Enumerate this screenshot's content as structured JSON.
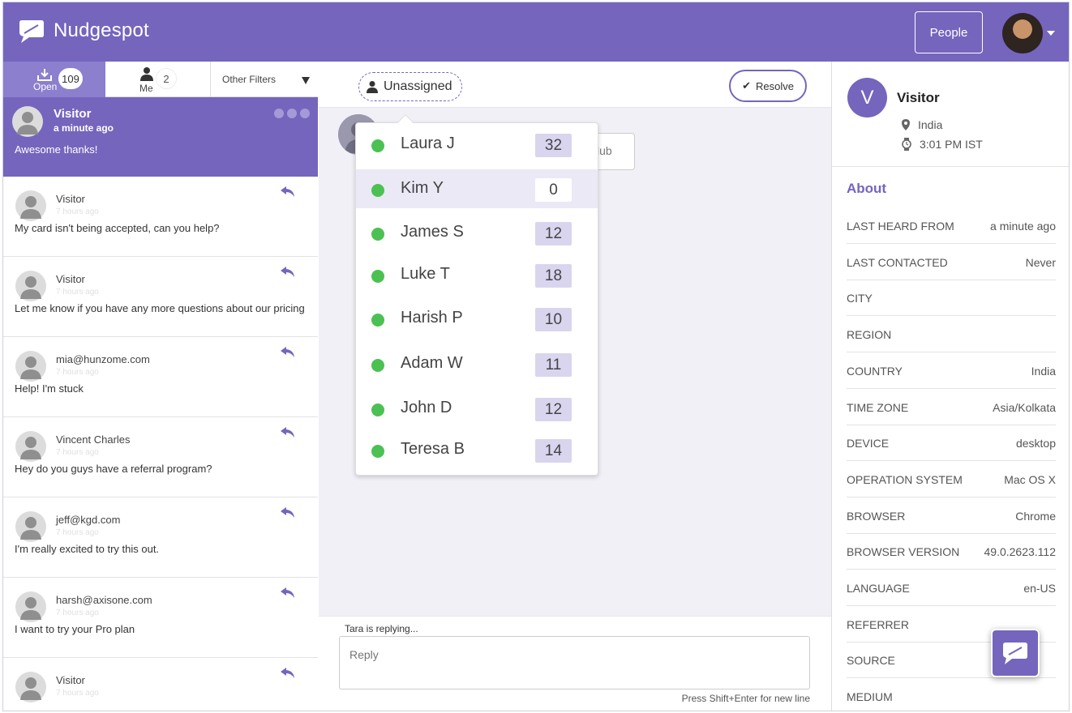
{
  "colors": {
    "brand": "#7565bd",
    "online": "#4cc153"
  },
  "header": {
    "app_name": "Nudgespot",
    "people_label": "People"
  },
  "filters": {
    "open_label": "Open",
    "open_count": "109",
    "me_label": "Me",
    "me_count": "2",
    "other_label": "Other Filters"
  },
  "active_conversation": {
    "name": "Visitor",
    "time": "a minute ago",
    "message": "Awesome thanks!"
  },
  "conversations": [
    {
      "name": "Visitor",
      "time": "7 hours ago",
      "message": "My card isn't being accepted, can you help?"
    },
    {
      "name": "Visitor",
      "time": "7 hours ago",
      "message": "Let me know if you have any more questions about our pricing"
    },
    {
      "name": "mia@hunzome.com",
      "time": "7 hours ago",
      "message": "Help! I'm stuck"
    },
    {
      "name": "Vincent Charles",
      "time": "7 hours ago",
      "message": "Hey do you guys have a referral program?"
    },
    {
      "name": "jeff@kgd.com",
      "time": "7 hours ago",
      "message": "I'm really excited to try this out."
    },
    {
      "name": "harsh@axisone.com",
      "time": "7 hours ago",
      "message": "I want to try your Pro plan"
    },
    {
      "name": "Visitor",
      "time": "7 hours ago",
      "message": ""
    }
  ],
  "toolbar": {
    "assign_label": "Unassigned",
    "resolve_label": "Resolve"
  },
  "message_partial": "lub",
  "agents": [
    {
      "name": "Laura J",
      "count": "32"
    },
    {
      "name": "Kim Y",
      "count": "0"
    },
    {
      "name": "James S",
      "count": "12"
    },
    {
      "name": "Luke T",
      "count": "18"
    },
    {
      "name": "Harish P",
      "count": "10"
    },
    {
      "name": "Adam W",
      "count": "11"
    },
    {
      "name": "John D",
      "count": "12"
    },
    {
      "name": "Teresa B",
      "count": "14"
    }
  ],
  "reply": {
    "status": "Tara is replying...",
    "placeholder": "Reply",
    "hint": "Press Shift+Enter for new line"
  },
  "profile": {
    "initial": "V",
    "name": "Visitor",
    "location": "India",
    "local_time": "3:01 PM IST"
  },
  "about": {
    "title": "About",
    "attributes": [
      {
        "key": "LAST HEARD FROM",
        "value": "a minute ago"
      },
      {
        "key": "LAST CONTACTED",
        "value": "Never"
      },
      {
        "key": "CITY",
        "value": ""
      },
      {
        "key": "REGION",
        "value": ""
      },
      {
        "key": "COUNTRY",
        "value": "India"
      },
      {
        "key": "TIME ZONE",
        "value": "Asia/Kolkata"
      },
      {
        "key": "DEVICE",
        "value": "desktop"
      },
      {
        "key": "OPERATION SYSTEM",
        "value": "Mac OS X"
      },
      {
        "key": "BROWSER",
        "value": "Chrome"
      },
      {
        "key": "BROWSER VERSION",
        "value": "49.0.2623.112"
      },
      {
        "key": "LANGUAGE",
        "value": "en-US"
      },
      {
        "key": "REFERRER",
        "value": ""
      },
      {
        "key": "SOURCE",
        "value": ""
      },
      {
        "key": "MEDIUM",
        "value": ""
      }
    ]
  }
}
